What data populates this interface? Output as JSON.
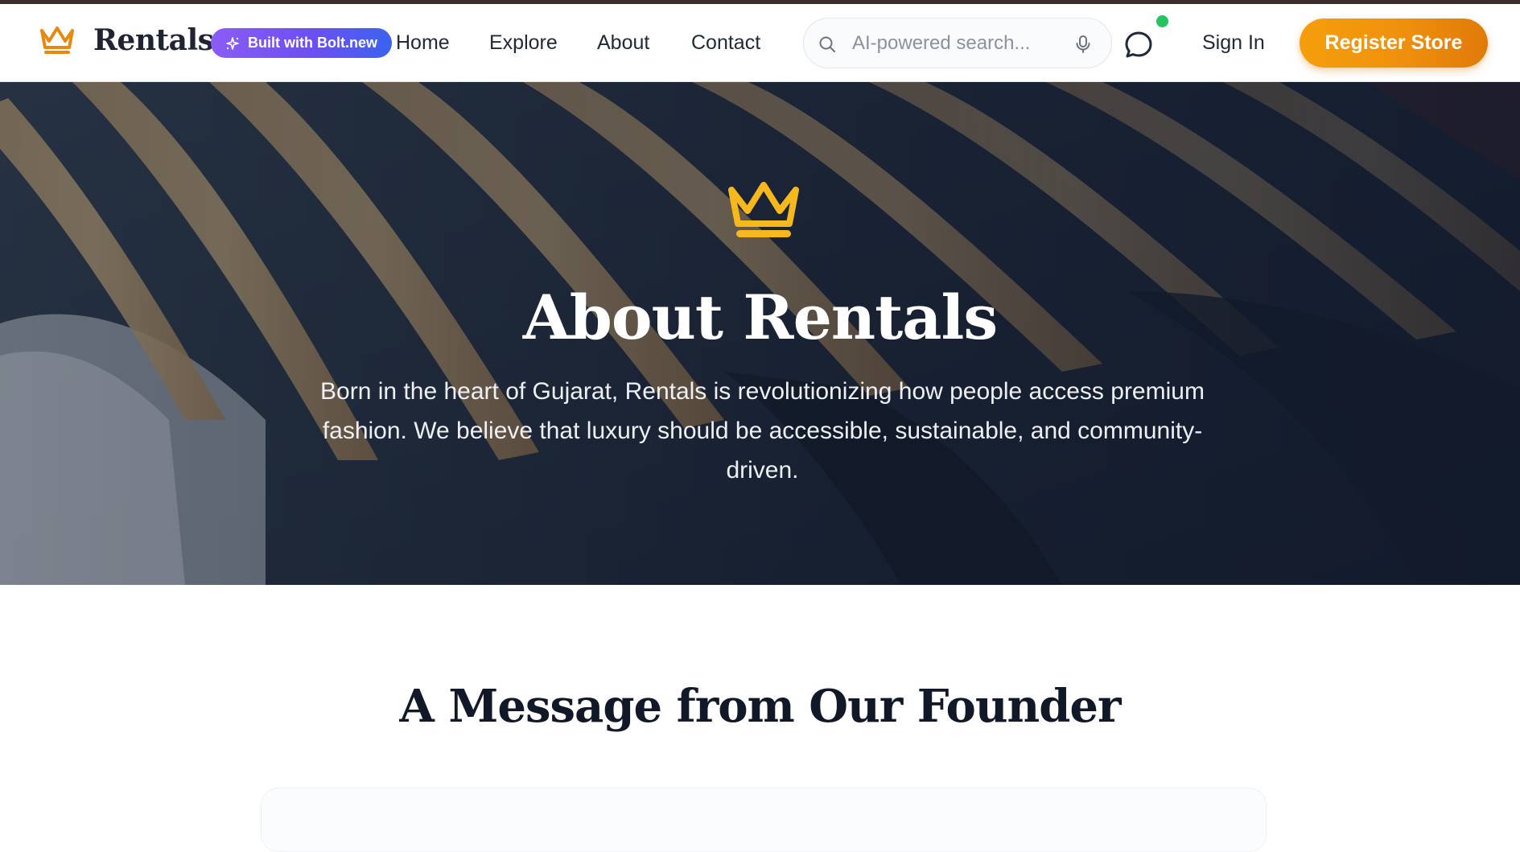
{
  "navbar": {
    "brand": "Rentals",
    "badge_label": "Built with Bolt.new",
    "links": [
      {
        "label": "Home"
      },
      {
        "label": "Explore"
      },
      {
        "label": "About"
      },
      {
        "label": "Contact"
      }
    ],
    "search_placeholder": "AI-powered search...",
    "chat_status": "online",
    "sign_in_label": "Sign In",
    "register_label": "Register Store"
  },
  "hero": {
    "title": "About Rentals",
    "description": "Born in the heart of Gujarat, Rentals is revolutionizing how people access premium fashion. We believe that luxury should be accessible, sustainable, and community-driven."
  },
  "founder": {
    "title": "A Message from Our Founder"
  },
  "icons": {
    "logo": "crown-icon",
    "badge": "sparkles-icon",
    "search": "search-icon",
    "mic": "microphone-icon",
    "chat": "chat-bubble-icon",
    "hero": "crown-icon"
  },
  "colors": {
    "accent_orange": "#f59e0b",
    "crown_gold": "#f6b81c",
    "badge_purple": "#7c4ff3",
    "online_green": "#22c55e",
    "text_dark": "#111827"
  }
}
